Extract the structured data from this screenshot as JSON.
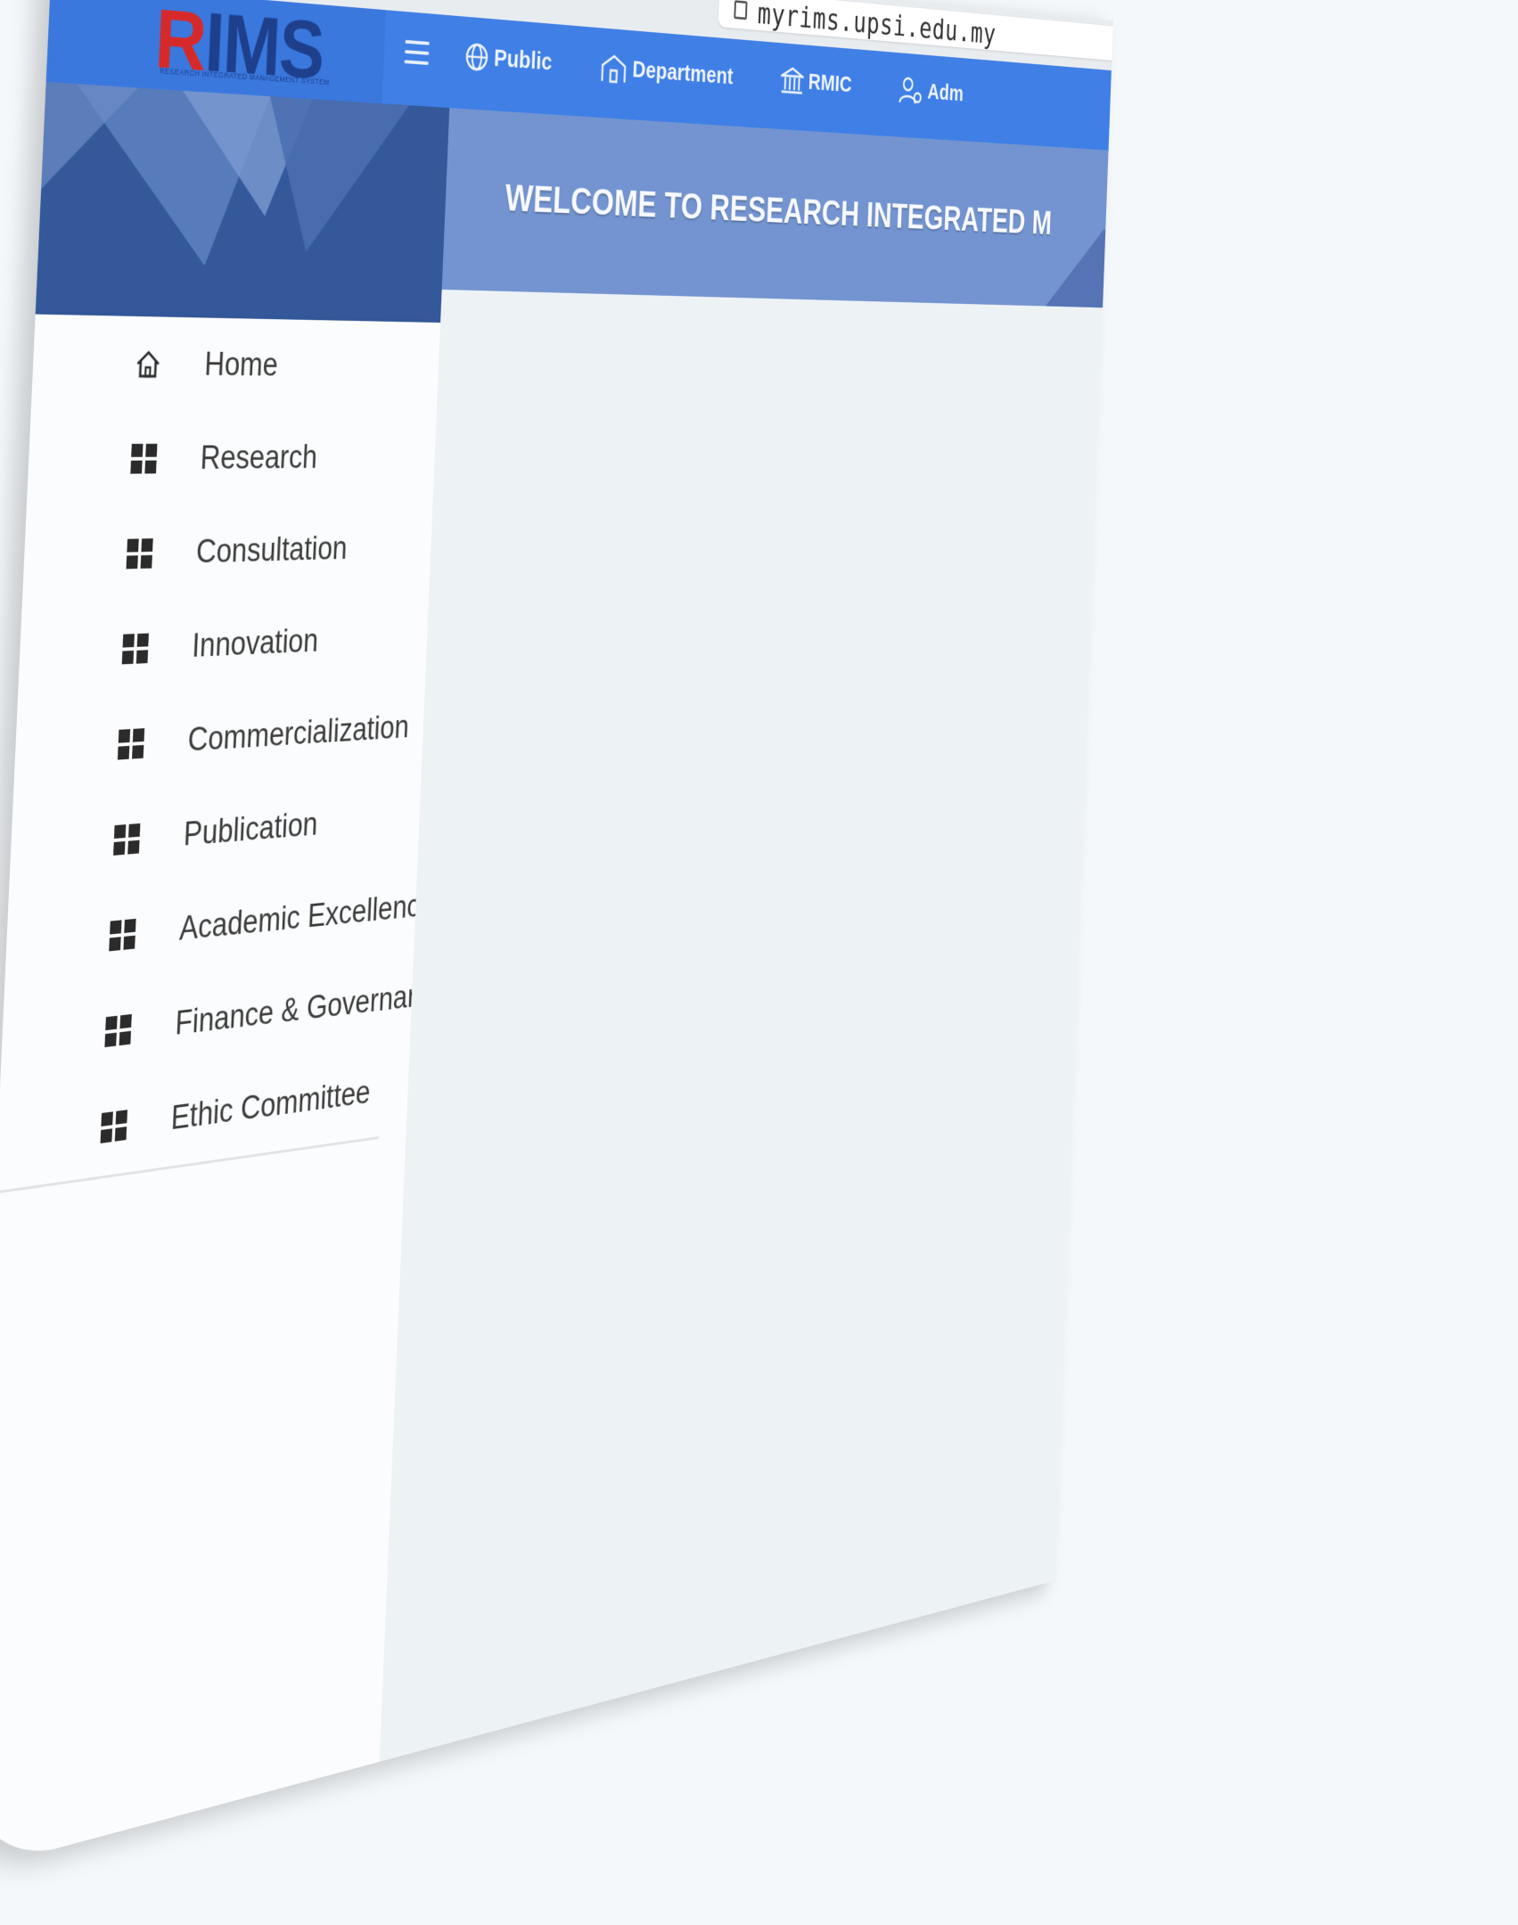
{
  "browser": {
    "url": "myrims.upsi.edu.my"
  },
  "header": {
    "logo_text": "RIMS",
    "logo_prefix": "R",
    "logo_rest": "IMS",
    "logo_subtitle": "RESEARCH INTEGRATED MANAGEMENT SYSTEM",
    "nav": [
      {
        "label": "Public",
        "icon": "globe-icon"
      },
      {
        "label": "Department",
        "icon": "building-icon"
      },
      {
        "label": "RMIC",
        "icon": "institution-icon"
      },
      {
        "label": "Adm",
        "icon": "admin-user-icon"
      }
    ]
  },
  "banner": {
    "welcome": "WELCOME TO RESEARCH INTEGRATED M"
  },
  "sidebar": {
    "items": [
      {
        "label": "Home",
        "icon": "home-icon"
      },
      {
        "label": "Research",
        "icon": "grid-icon"
      },
      {
        "label": "Consultation",
        "icon": "grid-icon"
      },
      {
        "label": "Innovation",
        "icon": "grid-icon"
      },
      {
        "label": "Commercialization",
        "icon": "grid-icon"
      },
      {
        "label": "Publication",
        "icon": "grid-icon"
      },
      {
        "label": "Academic Excellence",
        "icon": "grid-icon"
      },
      {
        "label": "Finance & Governance",
        "icon": "grid-icon"
      },
      {
        "label": "Ethic Committee",
        "icon": "grid-icon"
      }
    ]
  },
  "colors": {
    "nav_bg": "#3f7fe6",
    "sidebar_header_bg": "#34589a",
    "banner_bg": "#7394d0",
    "logo_blue": "#1e3f8c",
    "logo_red": "#d62a2a"
  }
}
